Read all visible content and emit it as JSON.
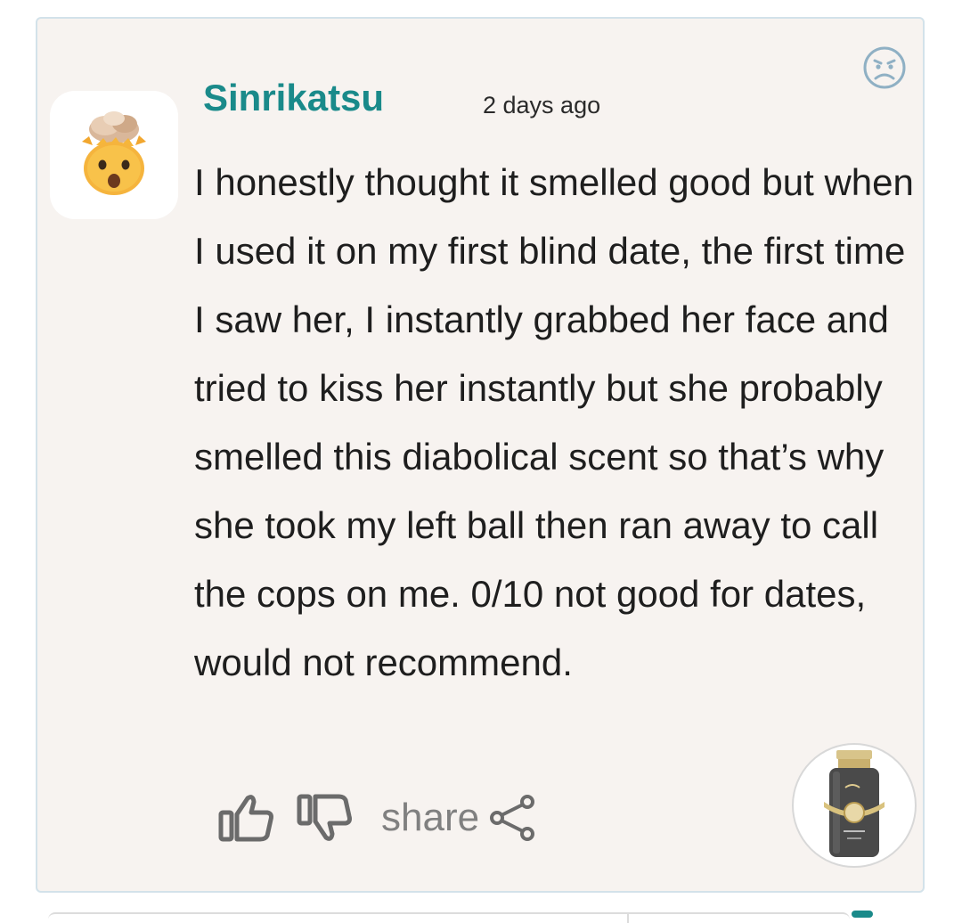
{
  "comment": {
    "username": "Sinrikatsu",
    "timestamp": "2 days ago",
    "body": "I honestly thought it smelled good but when I used it on my first blind date, the first time I saw her, I instantly grabbed her face and tried to kiss her instantly but she probably smelled this diabolical scent so that’s why she took my left ball then ran away to call the cops on me. 0/10 not good for dates, would not recommend.",
    "avatar_icon": "exploding-head-emoji",
    "mood_icon": "angry-face-icon"
  },
  "actions": {
    "like_icon": "thumbs-up-icon",
    "dislike_icon": "thumbs-down-icon",
    "share_label": "share",
    "share_icon": "share-icon"
  },
  "product": {
    "icon": "perfume-bottle-thumbnail"
  },
  "colors": {
    "card_background": "#f7f3f0",
    "card_border": "#d3e2ea",
    "username": "#1a8a8a",
    "mood_icon": "#8fb0c4"
  }
}
